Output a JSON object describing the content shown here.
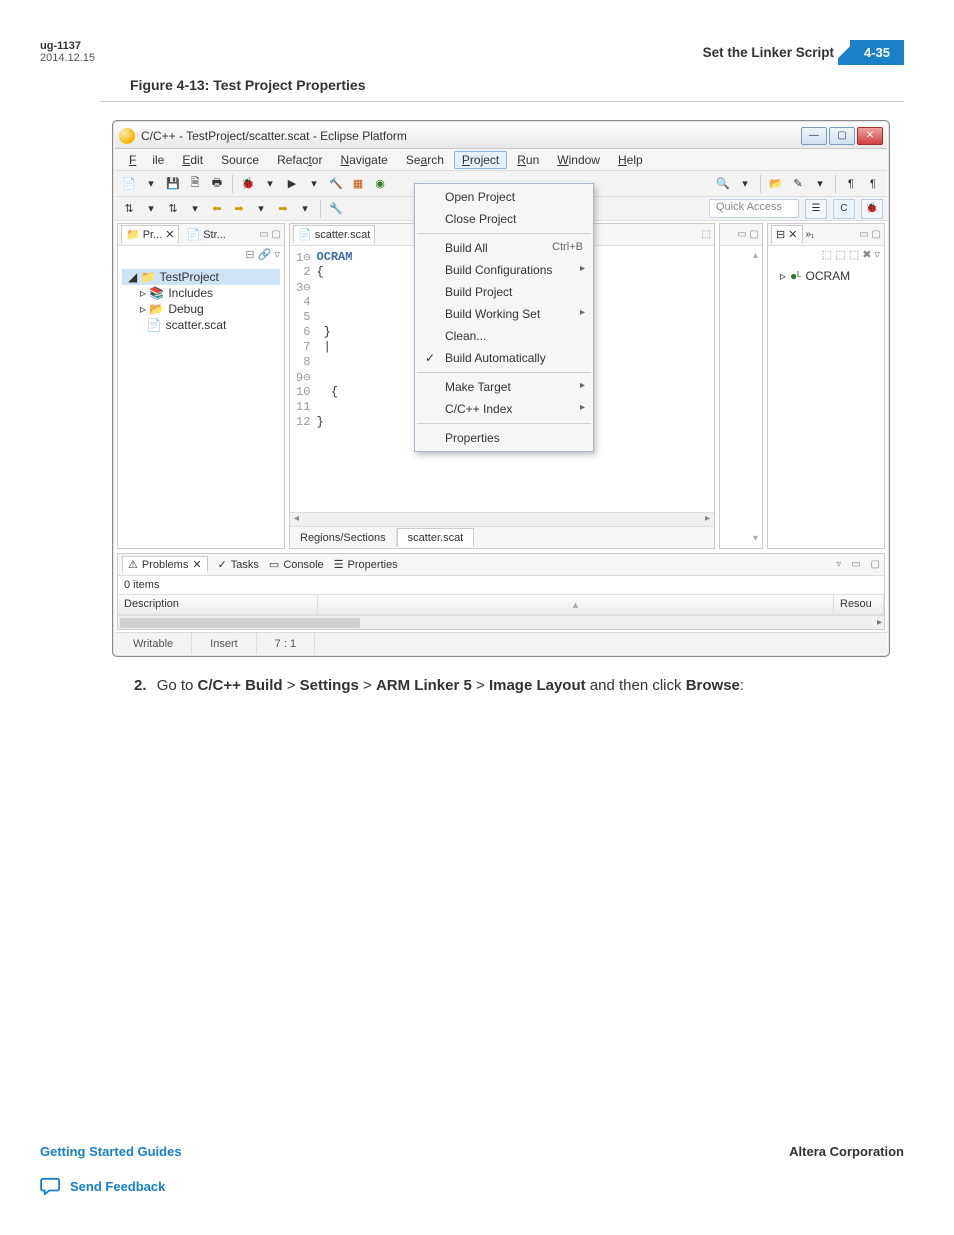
{
  "doc": {
    "code": "ug-1137",
    "date": "2014.12.15",
    "section": "Set the Linker Script",
    "pageNum": "4-35",
    "figureCaption": "Figure 4-13: Test Project Properties"
  },
  "window": {
    "title": "C/C++ - TestProject/scatter.scat - Eclipse Platform",
    "quickAccess": "Quick Access"
  },
  "menubar": {
    "file": "File",
    "edit": "Edit",
    "source": "Source",
    "refactor": "Refactor",
    "navigate": "Navigate",
    "search": "Search",
    "project": "Project",
    "run": "Run",
    "window": "Window",
    "help": "Help"
  },
  "projectMenu": {
    "open": "Open Project",
    "close": "Close Project",
    "buildAll": "Build All",
    "buildAllKey": "Ctrl+B",
    "buildConfigs": "Build Configurations",
    "buildProject": "Build Project",
    "buildWorking": "Build Working Set",
    "clean": "Clean...",
    "buildAuto": "Build Automatically",
    "makeTarget": "Make Target",
    "cIndex": "C/C++ Index",
    "properties": "Properties"
  },
  "projectExplorer": {
    "tab1": "Pr...",
    "tab2": "Str...",
    "node1": "TestProject",
    "node2": "Includes",
    "node3": "Debug",
    "node4": "scatter.scat"
  },
  "editor": {
    "tab": "scatter.scat",
    "line1": "OCRAM",
    "line2": "{",
    "line12": "}",
    "btab1": "Regions/Sections",
    "btab2": "scatter.scat"
  },
  "outline": {
    "item": "OCRAM"
  },
  "problems": {
    "tab1": "Problems",
    "tab2": "Tasks",
    "tab3": "Console",
    "tab4": "Properties",
    "items": "0 items",
    "col1": "Description",
    "col2": "Resou"
  },
  "statusbar": {
    "s1": "Writable",
    "s2": "Insert",
    "s3": "7 : 1"
  },
  "step": {
    "num": "2.",
    "pre": "Go to ",
    "p1": "C/C++ Build",
    "p2": "Settings",
    "p3": "ARM Linker 5",
    "p4": "Image Layout",
    "mid": " and then click ",
    "p5": "Browse",
    "end": ":"
  },
  "footer": {
    "left": "Getting Started Guides",
    "right": "Altera Corporation",
    "feedback": "Send Feedback"
  }
}
